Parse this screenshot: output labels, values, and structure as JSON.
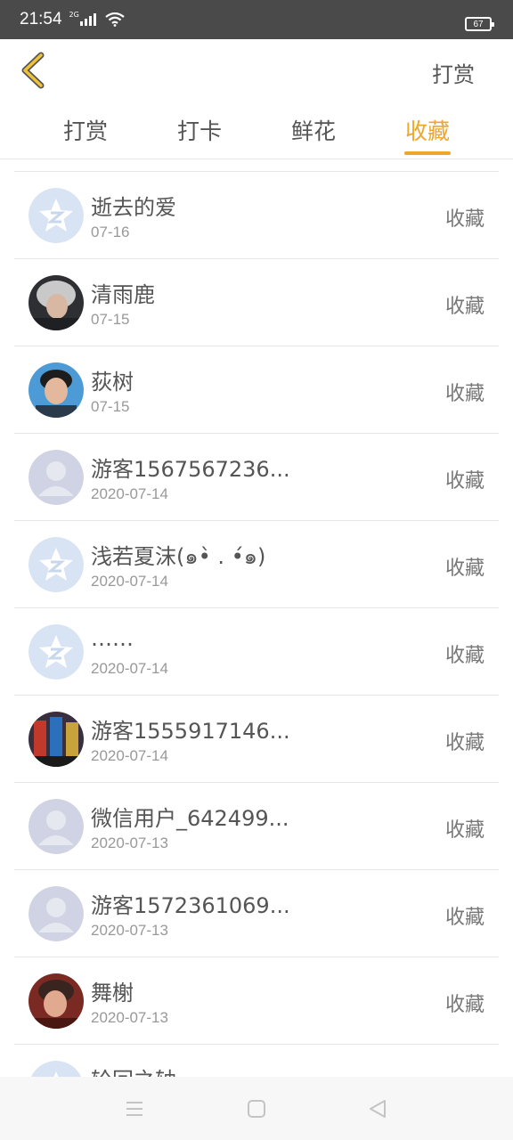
{
  "status_bar": {
    "time": "21:54",
    "network": "2G",
    "battery": "67"
  },
  "header": {
    "right_action": "打赏"
  },
  "tabs": [
    {
      "label": "打赏",
      "active": false
    },
    {
      "label": "打卡",
      "active": false
    },
    {
      "label": "鲜花",
      "active": false
    },
    {
      "label": "收藏",
      "active": true
    }
  ],
  "colors": {
    "accent": "#f0a62a",
    "status_bar": "#4a4a4a",
    "text": "#555555",
    "subtext": "#999999",
    "divider": "#e6e6e6"
  },
  "list": [
    {
      "name": "逝去的爱",
      "date": "07-16",
      "action": "收藏",
      "avatar": "qq-default-avatar-icon"
    },
    {
      "name": "清雨鹿",
      "date": "07-15",
      "action": "收藏",
      "avatar": "user-photo-avatar"
    },
    {
      "name": "荻树",
      "date": "07-15",
      "action": "收藏",
      "avatar": "user-photo-avatar"
    },
    {
      "name": "游客1567567236...",
      "date": "2020-07-14",
      "action": "收藏",
      "avatar": "default-person-avatar-icon"
    },
    {
      "name": "浅若夏沫(๑•̀ . •́๑)",
      "date": "2020-07-14",
      "action": "收藏",
      "avatar": "qq-default-avatar-icon"
    },
    {
      "name": "……",
      "date": "2020-07-14",
      "action": "收藏",
      "avatar": "qq-default-avatar-icon"
    },
    {
      "name": "游客1555917146...",
      "date": "2020-07-14",
      "action": "收藏",
      "avatar": "user-photo-avatar"
    },
    {
      "name": "微信用户_642499...",
      "date": "2020-07-13",
      "action": "收藏",
      "avatar": "default-person-avatar-icon"
    },
    {
      "name": "游客1572361069...",
      "date": "2020-07-13",
      "action": "收藏",
      "avatar": "default-person-avatar-icon"
    },
    {
      "name": "舞榭",
      "date": "2020-07-13",
      "action": "收藏",
      "avatar": "user-photo-avatar"
    },
    {
      "name": "轮回之轴",
      "date": "",
      "action": "",
      "avatar": "qq-default-avatar-icon"
    }
  ]
}
